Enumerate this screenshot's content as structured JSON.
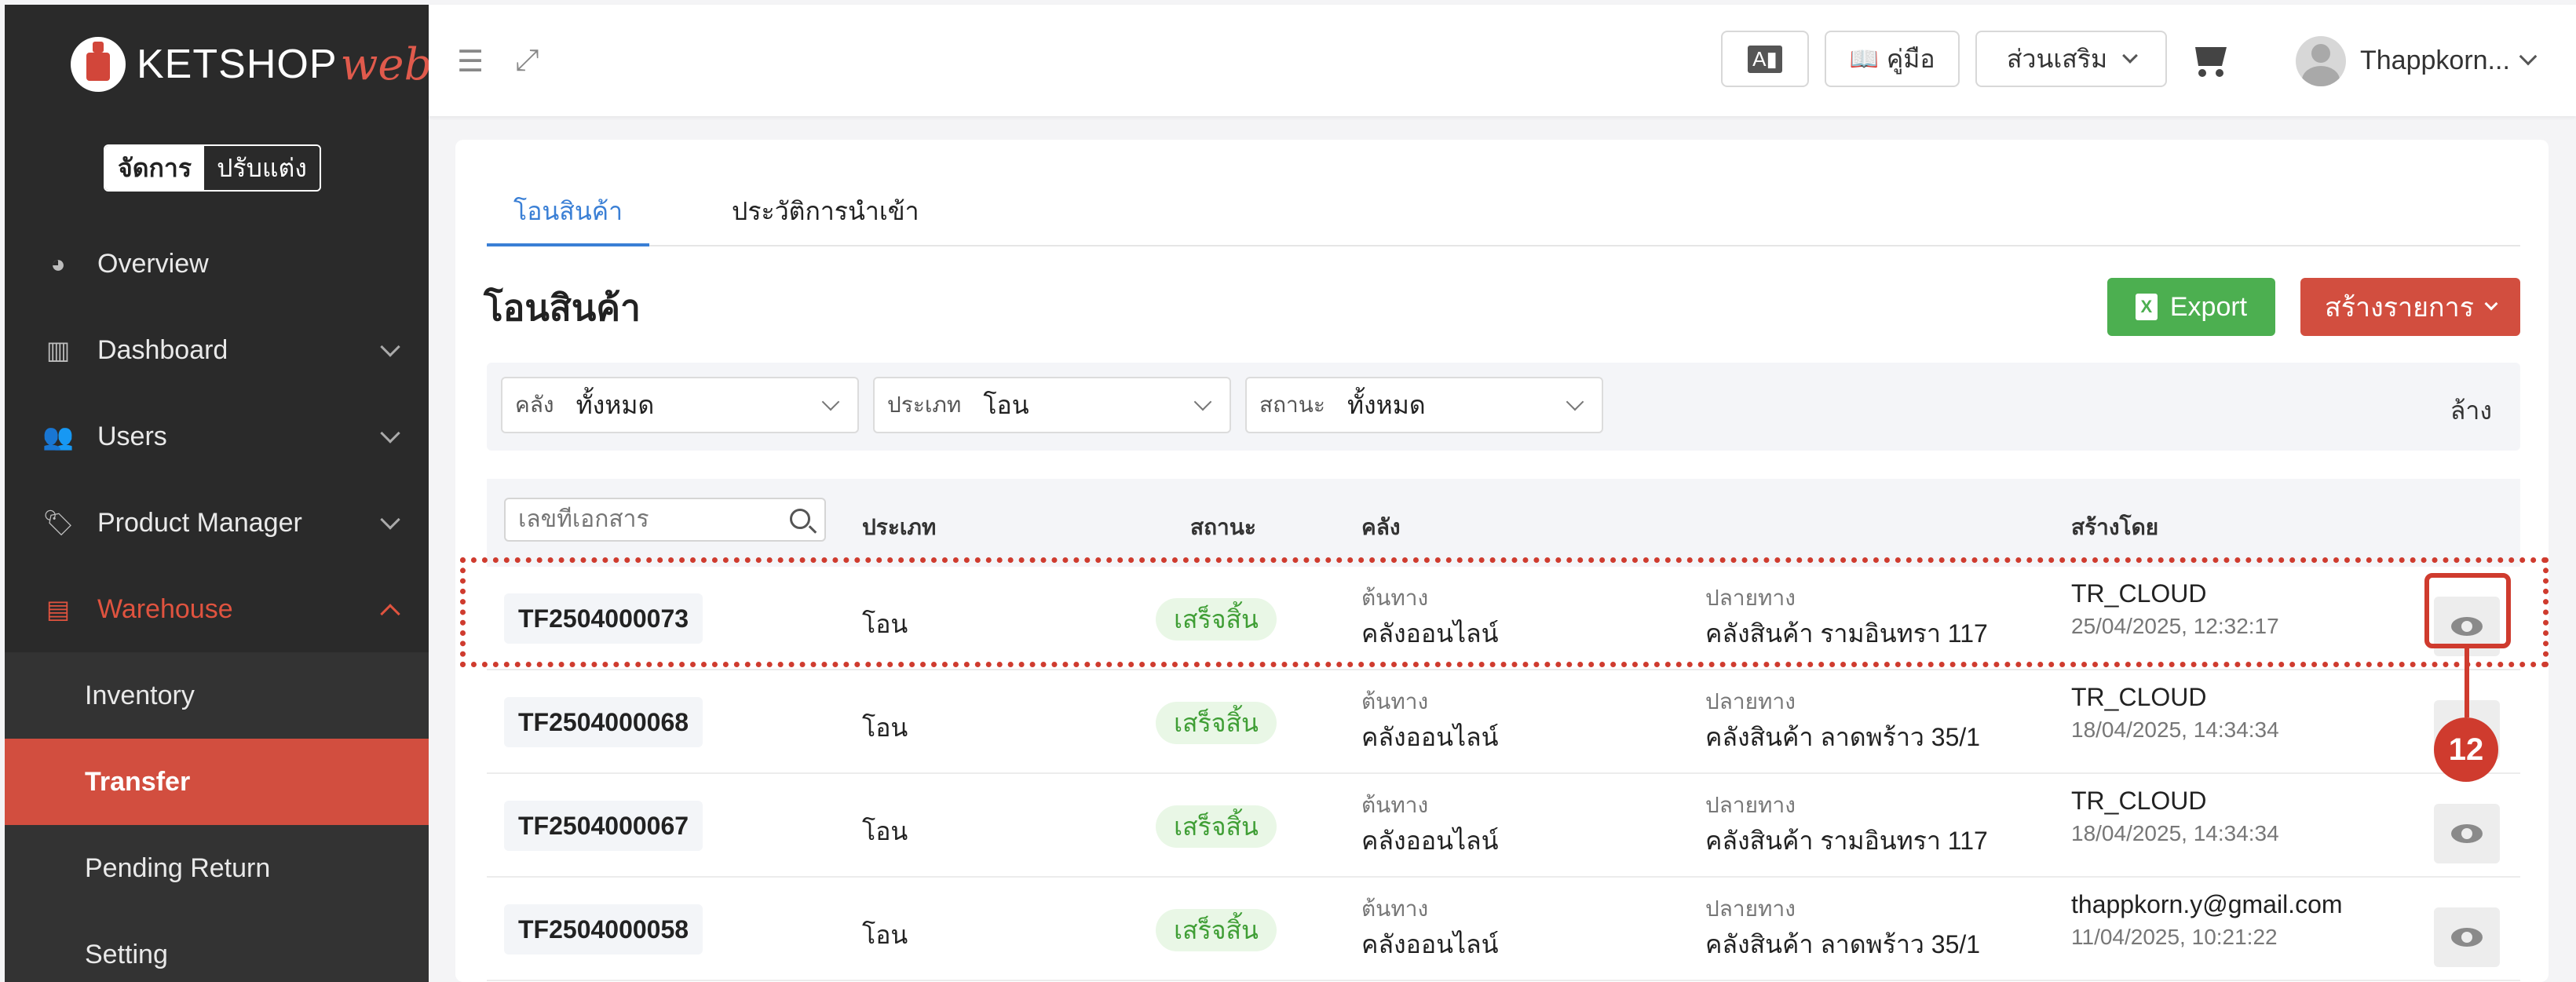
{
  "brand": {
    "name": "KETSHOP",
    "suffix": "web"
  },
  "mode_switch": {
    "manage": "จัดการ",
    "customize": "ปรับแต่ง"
  },
  "sidebar": {
    "items": [
      {
        "label": "Overview",
        "icon": "pie-chart-icon"
      },
      {
        "label": "Dashboard",
        "icon": "bar-chart-icon"
      },
      {
        "label": "Users",
        "icon": "users-icon"
      },
      {
        "label": "Product Manager",
        "icon": "tags-icon"
      },
      {
        "label": "Warehouse",
        "icon": "warehouse-icon"
      }
    ],
    "warehouse_sub": [
      {
        "label": "Inventory"
      },
      {
        "label": "Transfer"
      },
      {
        "label": "Pending Return"
      },
      {
        "label": "Setting"
      }
    ]
  },
  "topbar": {
    "manual_label": "คู่มือ",
    "addons_label": "ส่วนเสริม",
    "username": "Thappkorn..."
  },
  "tabs": [
    {
      "label": "โอนสินค้า"
    },
    {
      "label": "ประวัติการนำเข้า"
    }
  ],
  "page_title": "โอนสินค้า",
  "actions": {
    "export": "Export",
    "create": "สร้างรายการ"
  },
  "filters": [
    {
      "label": "คลัง",
      "value": "ทั้งหมด"
    },
    {
      "label": "ประเภท",
      "value": "โอน"
    },
    {
      "label": "สถานะ",
      "value": "ทั้งหมด"
    }
  ],
  "clear_label": "ล้าง",
  "search": {
    "placeholder": "เลขที่เอกสาร"
  },
  "columns": {
    "type": "ประเภท",
    "status": "สถานะ",
    "warehouse": "คลัง",
    "created_by": "สร้างโดย"
  },
  "rows": [
    {
      "doc": "TF2504000073",
      "type": "โอน",
      "status": "เสร็จสิ้น",
      "origin_label": "ต้นทาง",
      "origin": "คลังออนไลน์",
      "dest_label": "ปลายทาง",
      "dest": "คลังสินค้า รามอินทรา 117",
      "creator": "TR_CLOUD",
      "date": "25/04/2025, 12:32:17"
    },
    {
      "doc": "TF2504000068",
      "type": "โอน",
      "status": "เสร็จสิ้น",
      "origin_label": "ต้นทาง",
      "origin": "คลังออนไลน์",
      "dest_label": "ปลายทาง",
      "dest": "คลังสินค้า ลาดพร้าว 35/1",
      "creator": "TR_CLOUD",
      "date": "18/04/2025, 14:34:34"
    },
    {
      "doc": "TF2504000067",
      "type": "โอน",
      "status": "เสร็จสิ้น",
      "origin_label": "ต้นทาง",
      "origin": "คลังออนไลน์",
      "dest_label": "ปลายทาง",
      "dest": "คลังสินค้า รามอินทรา 117",
      "creator": "TR_CLOUD",
      "date": "18/04/2025, 14:34:34"
    },
    {
      "doc": "TF2504000058",
      "type": "โอน",
      "status": "เสร็จสิ้น",
      "origin_label": "ต้นทาง",
      "origin": "คลังออนไลน์",
      "dest_label": "ปลายทาง",
      "dest": "คลังสินค้า ลาดพร้าว 35/1",
      "creator": "thappkorn.y@gmail.com",
      "date": "11/04/2025, 10:21:22"
    }
  ],
  "annotation": {
    "step": "12"
  },
  "colors": {
    "accent": "#d24e3f",
    "link": "#3a7fd5",
    "export": "#4caf50",
    "success_text": "#3f9e35",
    "annotation": "#cf3b2e"
  }
}
